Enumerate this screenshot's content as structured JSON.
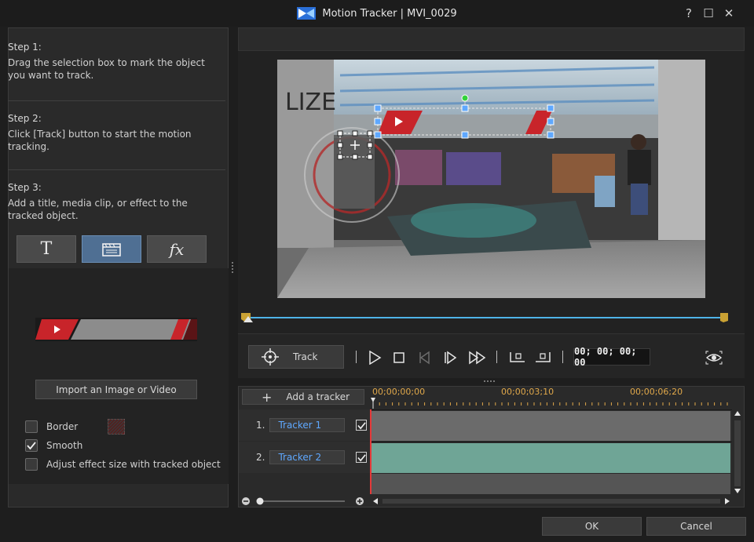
{
  "window": {
    "title": "Motion Tracker  |  MVI_0029",
    "help": "?",
    "maximize": "☐",
    "close": "✕"
  },
  "steps": [
    {
      "title": "Step 1:",
      "body": "Drag the selection box to mark the object you want to track."
    },
    {
      "title": "Step 2:",
      "body": "Click [Track] button to start the motion tracking."
    },
    {
      "title": "Step 3:",
      "body": "Add a title, media clip, or effect to the tracked object."
    }
  ],
  "tools": {
    "title_label": "T",
    "fx_label": "fx"
  },
  "import_label": "Import an Image or Video",
  "options": {
    "border": {
      "label": "Border",
      "checked": false
    },
    "smooth": {
      "label": "Smooth",
      "checked": true
    },
    "adjust": {
      "label": "Adjust effect size with tracked object",
      "checked": false
    }
  },
  "player": {
    "track_label": "Track",
    "timecode": "00; 00; 00; 00",
    "progress": 0.0
  },
  "timeline": {
    "add_tracker_label": "Add a tracker",
    "ticks": [
      "00;00;00;00",
      "00;00;03;10",
      "00;00;06;20"
    ],
    "trackers": [
      {
        "index": "1.",
        "name": "Tracker 1",
        "checked": true,
        "color": "#6b6b6b"
      },
      {
        "index": "2.",
        "name": "Tracker 2",
        "checked": true,
        "color": "#6fa596"
      }
    ]
  },
  "buttons": {
    "ok": "OK",
    "cancel": "Cancel"
  },
  "colors": {
    "accent_blue": "#5fa8ff",
    "timeline_orange": "#e0a84a",
    "playhead": "#e53a3a",
    "seek_blue": "#4fb3e8"
  }
}
